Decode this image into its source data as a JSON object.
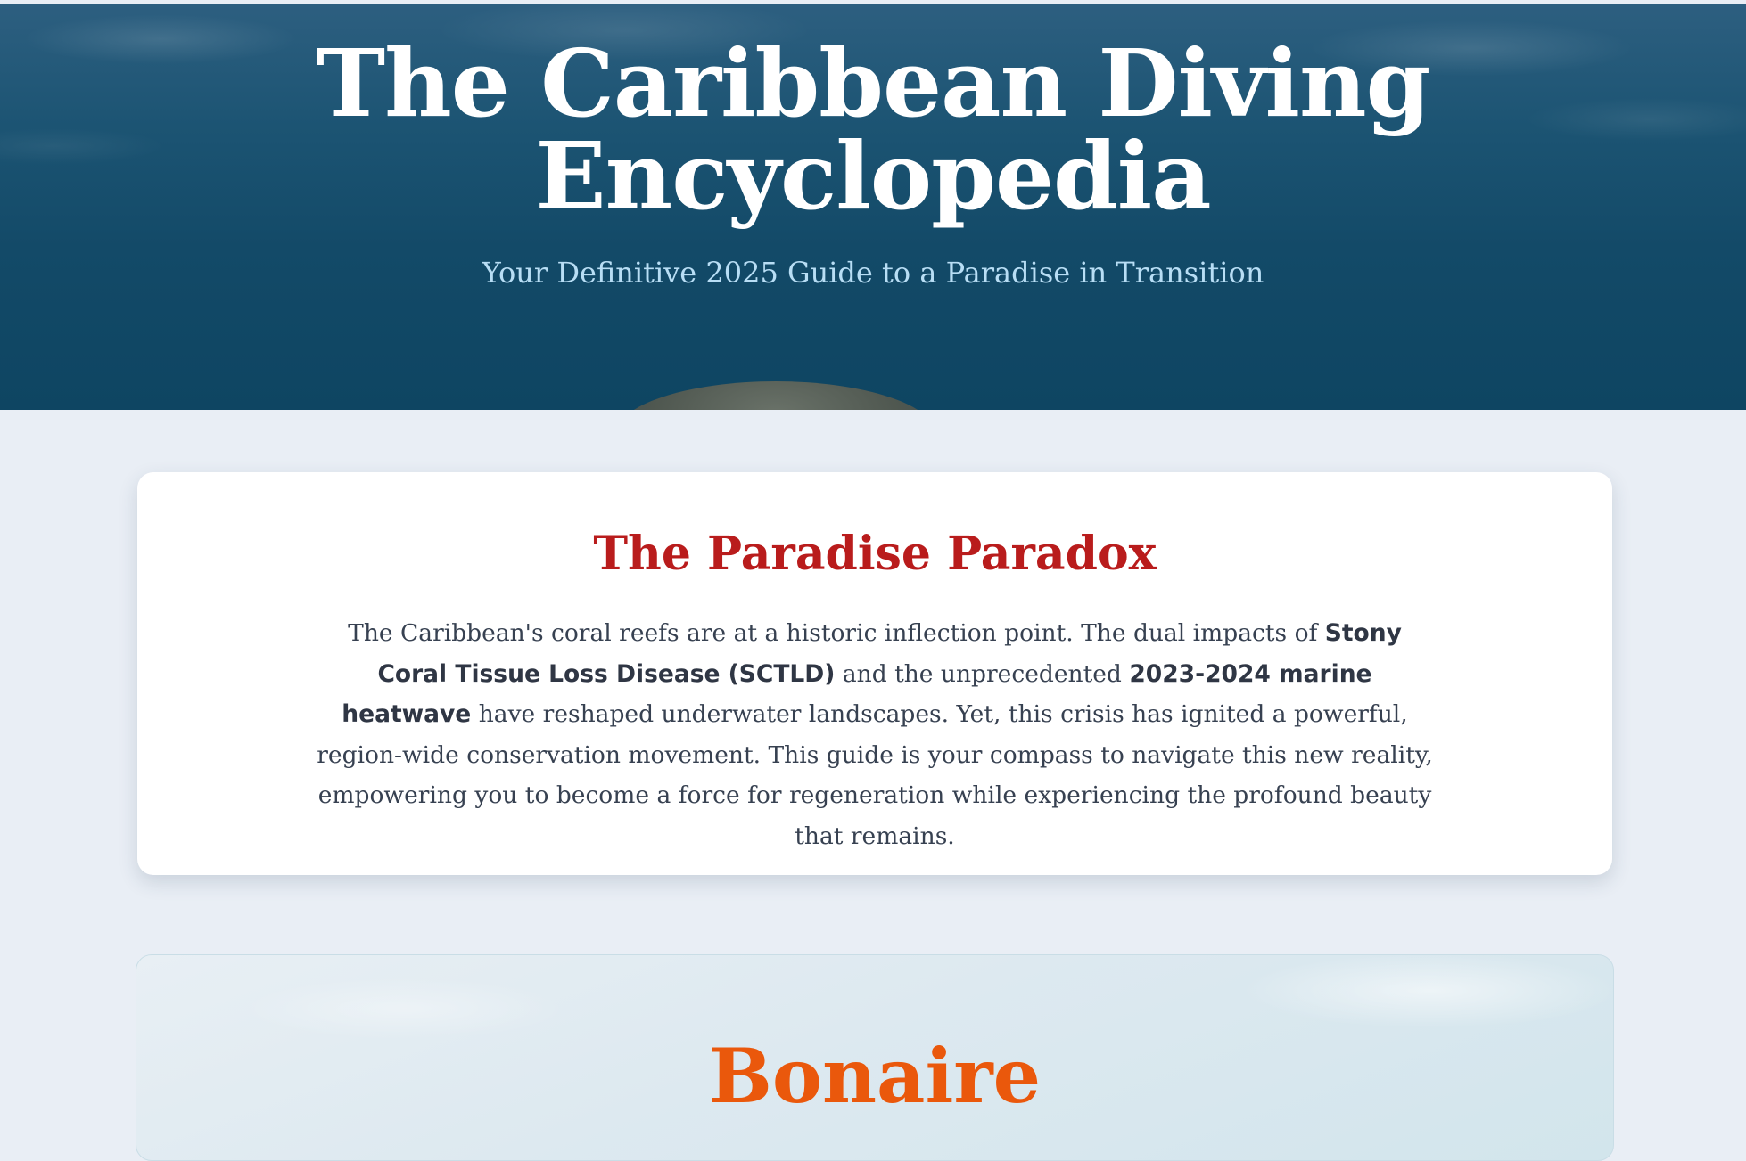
{
  "hero": {
    "title_line1": "The Caribbean Diving",
    "title_line2": "Encyclopedia",
    "subtitle": "Your Definitive 2025 Guide to a Paradise in Transition"
  },
  "intro": {
    "title": "The Paradise Paradox",
    "body_1": "The Caribbean's coral reefs are at a historic inflection point. The dual impacts of ",
    "bold_1": "Stony Coral Tissue Loss Disease (SCTLD)",
    "body_2": " and the unprecedented ",
    "bold_2": "2023-2024 marine heatwave",
    "body_3": " have reshaped underwater landscapes. Yet, this crisis has ignited a powerful, region-wide conservation movement. This guide is your compass to navigate this new reality, empowering you to become a force for regeneration while experiencing the profound beauty that remains."
  },
  "region": {
    "title": "Bonaire"
  },
  "colors": {
    "hero_bg": "#134a68",
    "intro_title": "#b91c1c",
    "region_title": "#ea580c",
    "subtitle": "#b8def5"
  }
}
